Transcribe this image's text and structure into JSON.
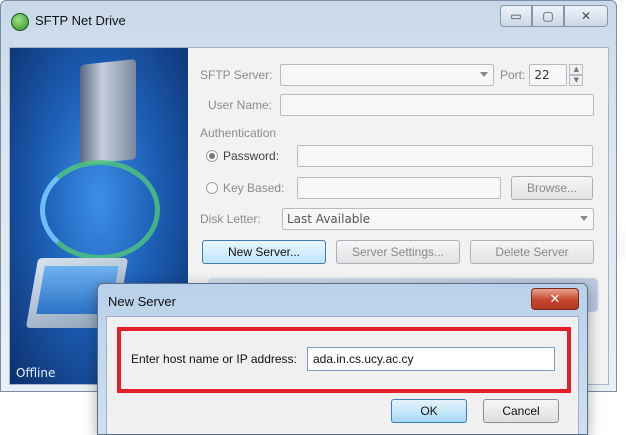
{
  "window": {
    "title": "SFTP Net Drive",
    "status": "Offline"
  },
  "form": {
    "server_label": "SFTP Server:",
    "server_value": "",
    "port_label": "Port:",
    "port_value": "22",
    "username_label": "User Name:",
    "username_value": "",
    "auth_label": "Authentication",
    "password_label": "Password:",
    "password_value": "",
    "keybased_label": "Key Based:",
    "keybased_value": "",
    "browse_label": "Browse...",
    "disk_label": "Disk Letter:",
    "disk_value": "Last Available",
    "new_server_label": "New Server...",
    "server_settings_label": "Server Settings...",
    "delete_server_label": "Delete Server"
  },
  "dialog": {
    "title": "New Server",
    "close_glyph": "✕",
    "host_label": "Enter host name or IP address:",
    "host_value": "ada.in.cs.ucy.ac.cy",
    "ok_label": "OK",
    "cancel_label": "Cancel"
  },
  "colors": {
    "highlight": "#e5202a",
    "accent": "#3c7fb1"
  }
}
